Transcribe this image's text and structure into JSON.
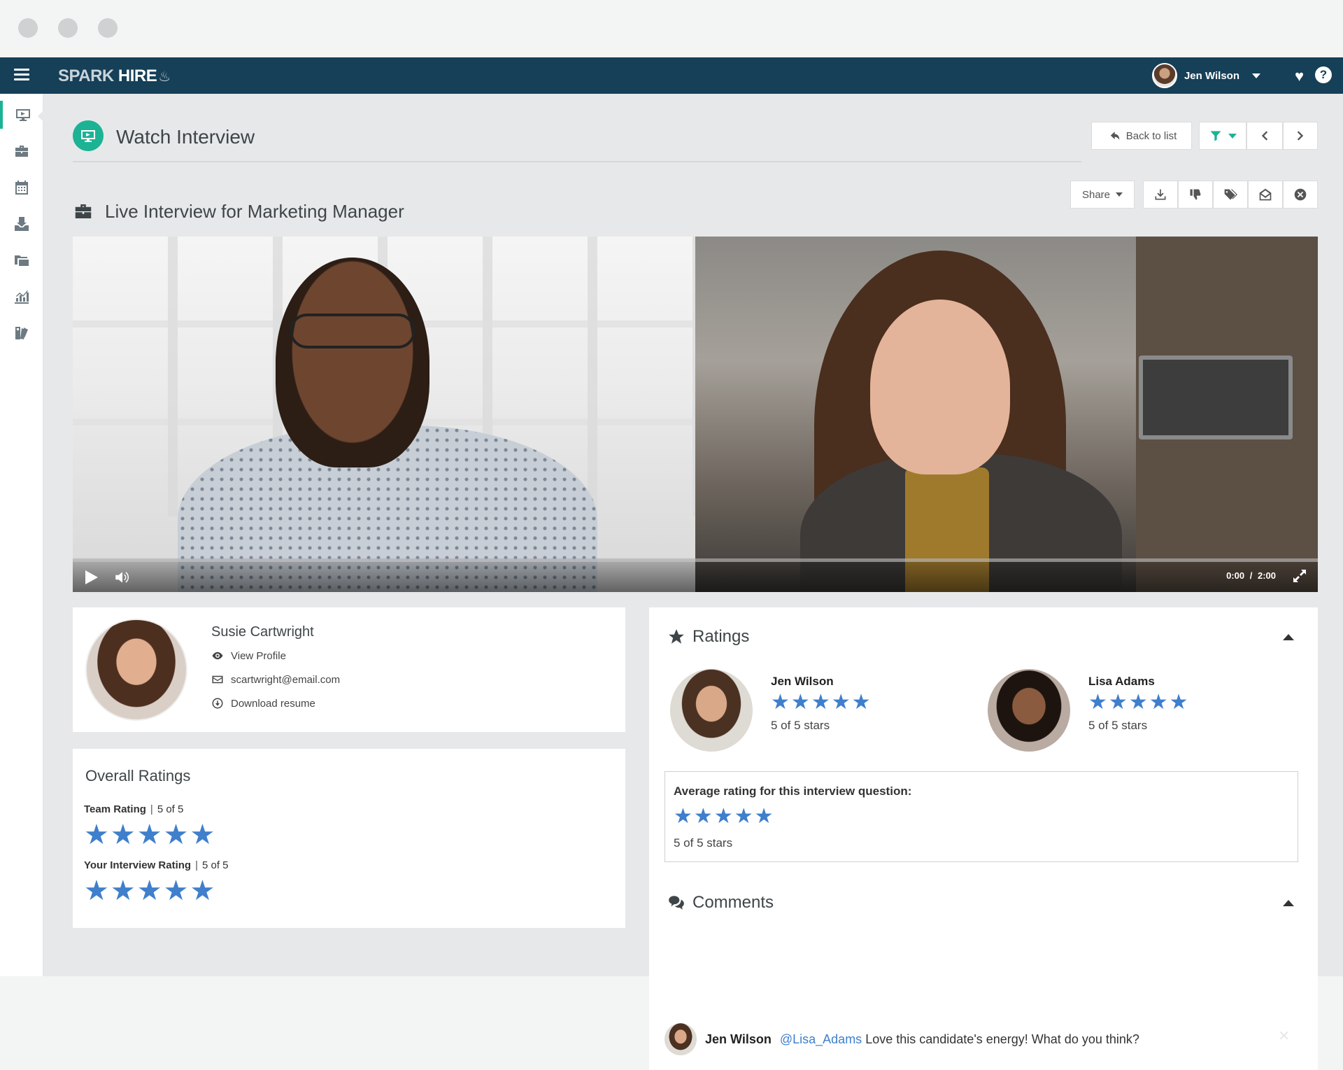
{
  "app": {
    "logo_spark": "SPARK",
    "logo_hire": "HIRE",
    "user_name": "Jen Wilson",
    "help_label": "?"
  },
  "colors": {
    "topbar": "#163f58",
    "accent": "#1bb394",
    "star": "#3f7fcc"
  },
  "sidebar": {
    "items": [
      {
        "icon": "monitor-icon",
        "active": true
      },
      {
        "icon": "briefcase-icon",
        "active": false
      },
      {
        "icon": "calendar-icon",
        "active": false
      },
      {
        "icon": "inbox-icon",
        "active": false
      },
      {
        "icon": "folders-icon",
        "active": false
      },
      {
        "icon": "analytics-icon",
        "active": false
      },
      {
        "icon": "tags-icon",
        "active": false
      }
    ]
  },
  "header": {
    "title": "Watch Interview",
    "back_label": "Back to list"
  },
  "interview": {
    "title": "Live Interview for Marketing Manager",
    "share_label": "Share"
  },
  "video": {
    "current_time": "0:00",
    "separator": "/",
    "duration": "2:00",
    "progress": 0
  },
  "candidate": {
    "name": "Susie Cartwright",
    "view_profile": "View Profile",
    "email": "scartwright@email.com",
    "download_resume": "Download resume"
  },
  "overall": {
    "title": "Overall Ratings",
    "team_label": "Team Rating",
    "team_value": "5 of 5",
    "team_stars": 5,
    "your_label": "Your Interview Rating",
    "your_value": "5 of 5",
    "your_stars": 5
  },
  "ratings": {
    "title": "Ratings",
    "raters": [
      {
        "name": "Jen Wilson",
        "stars": 5,
        "summary": "5 of 5 stars"
      },
      {
        "name": "Lisa Adams",
        "stars": 5,
        "summary": "5 of 5 stars"
      }
    ],
    "average_title": "Average rating for this interview question:",
    "average_stars": 5,
    "average_summary": "5 of 5 stars"
  },
  "comments": {
    "title": "Comments",
    "items": [
      {
        "author": "Jen Wilson",
        "mention": "@Lisa_Adams",
        "text": "Love this candidate's energy! What do you think?"
      }
    ]
  }
}
